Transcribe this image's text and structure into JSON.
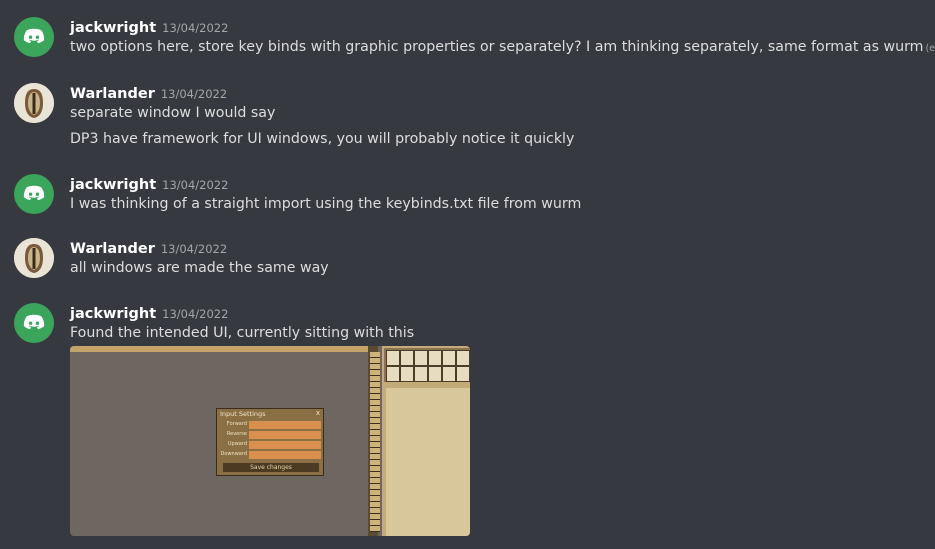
{
  "messages": [
    {
      "author": "jackwright",
      "timestamp": "13/04/2022",
      "avatar": "discord-logo-icon",
      "lines": [
        "two options here, store key binds with graphic properties or separately? I am thinking separately, same format as wurm"
      ],
      "edited_label": "(edited)"
    },
    {
      "author": "Warlander",
      "timestamp": "13/04/2022",
      "avatar": "warlander-avatar",
      "lines": [
        "separate window I would say",
        "DP3 have framework for UI windows, you will probably notice it quickly"
      ]
    },
    {
      "author": "jackwright",
      "timestamp": "13/04/2022",
      "avatar": "discord-logo-icon",
      "lines": [
        "I was thinking of a straight import using the keybinds.txt file from wurm"
      ]
    },
    {
      "author": "Warlander",
      "timestamp": "13/04/2022",
      "avatar": "warlander-avatar",
      "lines": [
        "all windows are made the same way"
      ]
    },
    {
      "author": "jackwright",
      "timestamp": "13/04/2022",
      "avatar": "discord-logo-icon",
      "lines": [
        "Found the intended UI, currently sitting with this"
      ]
    }
  ],
  "attachment": {
    "dialog_title": "Input Settings",
    "close_glyph": "x",
    "fields": [
      "Forward",
      "Reverse",
      "Upward",
      "Downward"
    ],
    "save_label": "Save changes"
  },
  "colors": {
    "background": "#36393f",
    "discord_avatar": "#3ba55c",
    "author": "#ffffff",
    "text": "#dcddde",
    "timestamp": "#a3a6aa"
  }
}
